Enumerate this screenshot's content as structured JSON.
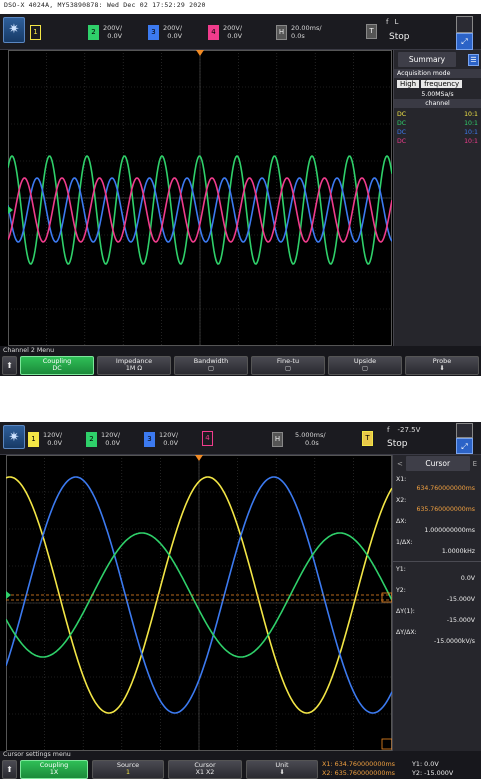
{
  "header_text": "DSO-X 4024A, MY53890878: Wed Dec 02 17:52:29 2020",
  "screen1": {
    "channels": [
      {
        "num": "1",
        "color": "#f3e646",
        "scale": "",
        "offset": "",
        "solid": false
      },
      {
        "num": "2",
        "color": "#2fd06a",
        "scale": "200V/",
        "offset": "0.0V",
        "solid": true
      },
      {
        "num": "3",
        "color": "#3c7af0",
        "scale": "200V/",
        "offset": "0.0V",
        "solid": true
      },
      {
        "num": "4",
        "color": "#f03c8c",
        "scale": "200V/",
        "offset": "0.0V",
        "solid": true
      }
    ],
    "h_icon": "H",
    "timebase": "20.00ms/",
    "delay": "0.0s",
    "trigger_icon": "T",
    "trigger_symbol": "f",
    "trigger_level": "L",
    "run_state": "Stop",
    "sidebar": {
      "title": "Summary",
      "acq_label": "Acquisition mode",
      "acq_mode": "High",
      "acq_resolution": "frequency",
      "sample_rate": "5.00MSa/s",
      "channel_header": "channel",
      "coupling_rows": [
        {
          "coupling": "DC",
          "ratio": "10:1",
          "color": "#f3e646"
        },
        {
          "coupling": "DC",
          "ratio": "10:1",
          "color": "#2fd06a"
        },
        {
          "coupling": "DC",
          "ratio": "10:1",
          "color": "#3c7af0"
        },
        {
          "coupling": "DC",
          "ratio": "10:1",
          "color": "#f03c8c"
        }
      ]
    },
    "menu_title": "Channel 2 Menu",
    "softkeys": [
      {
        "label": "Coupling",
        "value": "DC"
      },
      {
        "label": "Impedance",
        "value": "1M Ω"
      },
      {
        "label": "Bandwidth",
        "value": ""
      },
      {
        "label": "Fine-tu",
        "value": ""
      },
      {
        "label": "Upside",
        "value": ""
      },
      {
        "label": "Probe",
        "value": ""
      }
    ]
  },
  "screen2": {
    "channels": [
      {
        "num": "1",
        "color": "#f3e646",
        "scale": "120V/",
        "offset": "0.0V",
        "solid": true
      },
      {
        "num": "2",
        "color": "#2fd06a",
        "scale": "120V/",
        "offset": "0.0V",
        "solid": true
      },
      {
        "num": "3",
        "color": "#3c7af0",
        "scale": "120V/",
        "offset": "0.0V",
        "solid": true
      },
      {
        "num": "4",
        "color": "#f03c8c",
        "scale": "",
        "offset": "",
        "solid": false
      }
    ],
    "h_icon": "H",
    "timebase": "5.000ms/",
    "delay": "0.0s",
    "trigger_icon": "T",
    "trigger_symbol": "f",
    "trigger_level": "-27.5V",
    "run_state": "Stop",
    "sidebar": {
      "title": "Cursor",
      "x1_label": "X1:",
      "x1_value": "634.760000000ms",
      "x2_label": "X2:",
      "x2_value": "635.760000000ms",
      "dx_label": "ΔX:",
      "dx_value": "1.000000000ms",
      "inv_dx_label": "1/ΔX:",
      "inv_dx_value": "1.0000kHz",
      "y1_label": "Y1:",
      "y1_value": "0.0V",
      "y2_label": "Y2:",
      "y2_value": "-15.000V",
      "dy_label": "ΔY(1):",
      "dy_value": "-15.000V",
      "dydx_label": "ΔY/ΔX:",
      "dydx_value": "-15.0000kV/s"
    },
    "menu_title": "Cursor settings menu",
    "softkeys": [
      {
        "label": "Coupling",
        "value": "1X"
      },
      {
        "label": "Source",
        "value": "1"
      },
      {
        "label": "Cursor",
        "value": "X1 X2"
      },
      {
        "label": "Unit",
        "value": ""
      }
    ],
    "readout": {
      "x1": "X1: 634.760000000ms",
      "x2": "X2: 635.760000000ms",
      "y1": "Y1: 0.0V",
      "y2": "Y2: -15.000V"
    }
  }
}
